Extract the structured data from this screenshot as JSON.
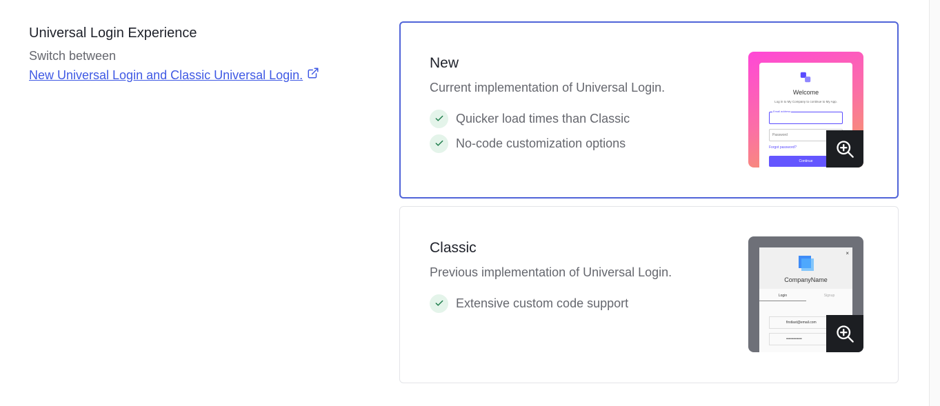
{
  "section": {
    "title": "Universal Login Experience",
    "subtitle": "Switch between",
    "link_text": "New Universal Login and Classic Universal Login."
  },
  "options": {
    "new": {
      "title": "New",
      "description": "Current implementation of Universal Login.",
      "features": [
        "Quicker load times than Classic",
        "No-code customization options"
      ],
      "selected": true,
      "preview": {
        "welcome": "Welcome",
        "subtext": "Log in to My Company to continue to My App.",
        "email_label": "Email address",
        "password_placeholder": "Password",
        "forgot": "Forgot password?",
        "button": "Continue"
      }
    },
    "classic": {
      "title": "Classic",
      "description": "Previous implementation of Universal Login.",
      "features": [
        "Extensive custom code support"
      ],
      "selected": false,
      "preview": {
        "company": "CompanyName",
        "tab_login": "Login",
        "tab_signup": "Signup",
        "email": "firstlast@email.com",
        "password": "•••••••••••••",
        "close": "×"
      }
    }
  },
  "colors": {
    "accent": "#3f59e4",
    "selected_border": "#4f63d8",
    "check_bg": "#e4f4ea",
    "check": "#1c7c4a"
  },
  "icons": {
    "link": "external-link-icon",
    "check": "check-icon",
    "zoom": "zoom-in-icon"
  }
}
